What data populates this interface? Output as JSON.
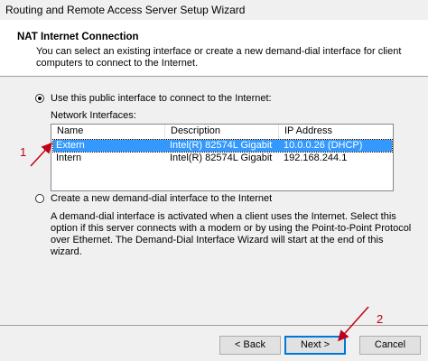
{
  "window": {
    "title": "Routing and Remote Access Server Setup Wizard"
  },
  "header": {
    "title": "NAT Internet Connection",
    "description": "You can select an existing interface or create a new demand-dial interface for client computers to connect to the Internet."
  },
  "option_public": {
    "label": "Use this public interface to connect to the Internet:",
    "selected": true
  },
  "network_interfaces": {
    "label": "Network Interfaces:",
    "columns": [
      "Name",
      "Description",
      "IP Address"
    ],
    "rows": [
      {
        "name": "Extern",
        "description": "Intel(R) 82574L Gigabit ...",
        "ip": "10.0.0.26 (DHCP)",
        "selected": true
      },
      {
        "name": "Intern",
        "description": "Intel(R) 82574L Gigabit ...",
        "ip": "192.168.244.1",
        "selected": false
      }
    ]
  },
  "option_demand_dial": {
    "label": "Create a new demand-dial interface to the Internet",
    "selected": false,
    "description": "A demand-dial interface is activated when a client uses the Internet. Select this option if this server connects with a modem or by using the Point-to-Point Protocol over Ethernet. The Demand-Dial Interface Wizard will start at the end of this wizard."
  },
  "buttons": {
    "back": "< Back",
    "next": "Next >",
    "cancel": "Cancel"
  },
  "annotations": {
    "marker1": "1",
    "marker2": "2",
    "color": "#c0001a"
  }
}
